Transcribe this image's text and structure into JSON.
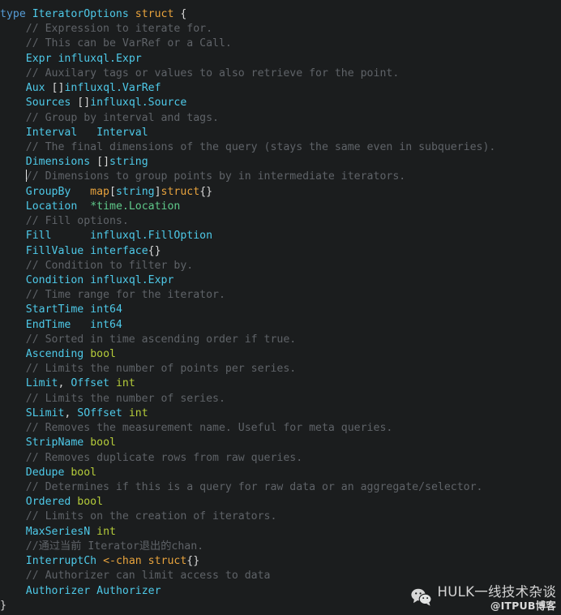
{
  "editor": {
    "background_color": "#1b1d1e",
    "language": "go",
    "cursor_line": 10,
    "cursor_column": 0
  },
  "theme": {
    "comment_color": "#5f6368",
    "keyword_color": "#569cd6",
    "identifier_color": "#4ec9e8",
    "type_color": "#e8a33d",
    "builtin_color": "#b5cc3a",
    "green_color": "#5fc98a",
    "punctuation_color": "#d8d8d8"
  },
  "code": {
    "lines": [
      {
        "id": "line-1",
        "indent": 0,
        "tokens": [
          {
            "t": "type",
            "c": "keyword"
          },
          {
            "t": " ",
            "c": "plain"
          },
          {
            "t": "IteratorOptions",
            "c": "ident"
          },
          {
            "t": " ",
            "c": "plain"
          },
          {
            "t": "struct",
            "c": "type"
          },
          {
            "t": " ",
            "c": "plain"
          },
          {
            "t": "{",
            "c": "punct"
          }
        ]
      },
      {
        "id": "line-2",
        "indent": 1,
        "tokens": [
          {
            "t": "// Expression to iterate for.",
            "c": "comment"
          }
        ]
      },
      {
        "id": "line-3",
        "indent": 1,
        "tokens": [
          {
            "t": "// This can be VarRef or a Call.",
            "c": "comment"
          }
        ]
      },
      {
        "id": "line-4",
        "indent": 1,
        "tokens": [
          {
            "t": "Expr",
            "c": "ident"
          },
          {
            "t": " ",
            "c": "plain"
          },
          {
            "t": "influxql.Expr",
            "c": "ident"
          }
        ]
      },
      {
        "id": "line-5",
        "indent": 1,
        "tokens": [
          {
            "t": "// Auxilary tags or values to also retrieve for the point.",
            "c": "comment"
          }
        ]
      },
      {
        "id": "line-6",
        "indent": 1,
        "tokens": [
          {
            "t": "Aux",
            "c": "ident"
          },
          {
            "t": " ",
            "c": "plain"
          },
          {
            "t": "[]",
            "c": "punct"
          },
          {
            "t": "influxql.VarRef",
            "c": "ident"
          }
        ]
      },
      {
        "id": "line-7",
        "indent": 1,
        "tokens": [
          {
            "t": "Sources",
            "c": "ident"
          },
          {
            "t": " ",
            "c": "plain"
          },
          {
            "t": "[]",
            "c": "punct"
          },
          {
            "t": "influxql.Source",
            "c": "ident"
          }
        ]
      },
      {
        "id": "line-8",
        "indent": 1,
        "tokens": [
          {
            "t": "// Group by interval and tags.",
            "c": "comment"
          }
        ]
      },
      {
        "id": "line-9",
        "indent": 1,
        "tokens": [
          {
            "t": "Interval",
            "c": "ident"
          },
          {
            "t": "   ",
            "c": "plain"
          },
          {
            "t": "Interval",
            "c": "ident"
          }
        ]
      },
      {
        "id": "line-10",
        "indent": 1,
        "tokens": [
          {
            "t": "// The final dimensions of the query (stays the same even in subqueries).",
            "c": "comment"
          }
        ]
      },
      {
        "id": "line-11",
        "indent": 1,
        "tokens": [
          {
            "t": "Dimensions",
            "c": "ident"
          },
          {
            "t": " ",
            "c": "plain"
          },
          {
            "t": "[]",
            "c": "punct"
          },
          {
            "t": "string",
            "c": "ident"
          }
        ]
      },
      {
        "id": "line-12",
        "indent": 1,
        "caret": true,
        "tokens": [
          {
            "t": "// Dimensions to group points by in intermediate iterators.",
            "c": "comment"
          }
        ]
      },
      {
        "id": "line-13",
        "indent": 1,
        "tokens": [
          {
            "t": "GroupBy",
            "c": "ident"
          },
          {
            "t": "   ",
            "c": "plain"
          },
          {
            "t": "map",
            "c": "type"
          },
          {
            "t": "[",
            "c": "punct"
          },
          {
            "t": "string",
            "c": "ident"
          },
          {
            "t": "]",
            "c": "punct"
          },
          {
            "t": "struct",
            "c": "type"
          },
          {
            "t": "{}",
            "c": "punct"
          }
        ]
      },
      {
        "id": "line-14",
        "indent": 1,
        "tokens": [
          {
            "t": "Location",
            "c": "ident"
          },
          {
            "t": "  ",
            "c": "plain"
          },
          {
            "t": "*time.Location",
            "c": "green"
          }
        ]
      },
      {
        "id": "line-15",
        "indent": 1,
        "tokens": [
          {
            "t": "// Fill options.",
            "c": "comment"
          }
        ]
      },
      {
        "id": "line-16",
        "indent": 1,
        "tokens": [
          {
            "t": "Fill",
            "c": "ident"
          },
          {
            "t": "      ",
            "c": "plain"
          },
          {
            "t": "influxql.FillOption",
            "c": "ident"
          }
        ]
      },
      {
        "id": "line-17",
        "indent": 1,
        "tokens": [
          {
            "t": "FillValue",
            "c": "ident"
          },
          {
            "t": " ",
            "c": "plain"
          },
          {
            "t": "interface",
            "c": "ident"
          },
          {
            "t": "{}",
            "c": "punct"
          }
        ]
      },
      {
        "id": "line-18",
        "indent": 1,
        "tokens": [
          {
            "t": "// Condition to filter by.",
            "c": "comment"
          }
        ]
      },
      {
        "id": "line-19",
        "indent": 1,
        "tokens": [
          {
            "t": "Condition",
            "c": "ident"
          },
          {
            "t": " ",
            "c": "plain"
          },
          {
            "t": "influxql.Expr",
            "c": "ident"
          }
        ]
      },
      {
        "id": "line-20",
        "indent": 1,
        "tokens": [
          {
            "t": "// Time range for the iterator.",
            "c": "comment"
          }
        ]
      },
      {
        "id": "line-21",
        "indent": 1,
        "tokens": [
          {
            "t": "StartTime",
            "c": "ident"
          },
          {
            "t": " ",
            "c": "plain"
          },
          {
            "t": "int64",
            "c": "ident"
          }
        ]
      },
      {
        "id": "line-22",
        "indent": 1,
        "tokens": [
          {
            "t": "EndTime",
            "c": "ident"
          },
          {
            "t": "   ",
            "c": "plain"
          },
          {
            "t": "int64",
            "c": "ident"
          }
        ]
      },
      {
        "id": "line-23",
        "indent": 1,
        "tokens": [
          {
            "t": "// Sorted in time ascending order if true.",
            "c": "comment"
          }
        ]
      },
      {
        "id": "line-24",
        "indent": 1,
        "tokens": [
          {
            "t": "Ascending",
            "c": "ident"
          },
          {
            "t": " ",
            "c": "plain"
          },
          {
            "t": "bool",
            "c": "builtin"
          }
        ]
      },
      {
        "id": "line-25",
        "indent": 1,
        "tokens": [
          {
            "t": "// Limits the number of points per series.",
            "c": "comment"
          }
        ]
      },
      {
        "id": "line-26",
        "indent": 1,
        "tokens": [
          {
            "t": "Limit",
            "c": "ident"
          },
          {
            "t": ", ",
            "c": "punct"
          },
          {
            "t": "Offset",
            "c": "ident"
          },
          {
            "t": " ",
            "c": "plain"
          },
          {
            "t": "int",
            "c": "builtin"
          }
        ]
      },
      {
        "id": "line-27",
        "indent": 1,
        "tokens": [
          {
            "t": "// Limits the number of series.",
            "c": "comment"
          }
        ]
      },
      {
        "id": "line-28",
        "indent": 1,
        "tokens": [
          {
            "t": "SLimit",
            "c": "ident"
          },
          {
            "t": ", ",
            "c": "punct"
          },
          {
            "t": "SOffset",
            "c": "ident"
          },
          {
            "t": " ",
            "c": "plain"
          },
          {
            "t": "int",
            "c": "builtin"
          }
        ]
      },
      {
        "id": "line-29",
        "indent": 1,
        "tokens": [
          {
            "t": "// Removes the measurement name. Useful for meta queries.",
            "c": "comment"
          }
        ]
      },
      {
        "id": "line-30",
        "indent": 1,
        "tokens": [
          {
            "t": "StripName",
            "c": "ident"
          },
          {
            "t": " ",
            "c": "plain"
          },
          {
            "t": "bool",
            "c": "builtin"
          }
        ]
      },
      {
        "id": "line-31",
        "indent": 1,
        "tokens": [
          {
            "t": "// Removes duplicate rows from raw queries.",
            "c": "comment"
          }
        ]
      },
      {
        "id": "line-32",
        "indent": 1,
        "tokens": [
          {
            "t": "Dedupe",
            "c": "ident"
          },
          {
            "t": " ",
            "c": "plain"
          },
          {
            "t": "bool",
            "c": "builtin"
          }
        ]
      },
      {
        "id": "line-33",
        "indent": 1,
        "tokens": [
          {
            "t": "// Determines if this is a query for raw data or an aggregate/selector.",
            "c": "comment"
          }
        ]
      },
      {
        "id": "line-34",
        "indent": 1,
        "tokens": [
          {
            "t": "Ordered",
            "c": "ident"
          },
          {
            "t": " ",
            "c": "plain"
          },
          {
            "t": "bool",
            "c": "builtin"
          }
        ]
      },
      {
        "id": "line-35",
        "indent": 1,
        "tokens": [
          {
            "t": "// Limits on the creation of iterators.",
            "c": "comment"
          }
        ]
      },
      {
        "id": "line-36",
        "indent": 1,
        "tokens": [
          {
            "t": "MaxSeriesN",
            "c": "ident"
          },
          {
            "t": " ",
            "c": "plain"
          },
          {
            "t": "int",
            "c": "builtin"
          }
        ]
      },
      {
        "id": "line-37",
        "indent": 1,
        "tokens": [
          {
            "t": "//通过当前 Iterator退出的chan.",
            "c": "comment"
          }
        ]
      },
      {
        "id": "line-38",
        "indent": 1,
        "tokens": [
          {
            "t": "InterruptCh",
            "c": "ident"
          },
          {
            "t": " ",
            "c": "plain"
          },
          {
            "t": "<-chan",
            "c": "type"
          },
          {
            "t": " ",
            "c": "plain"
          },
          {
            "t": "struct",
            "c": "type"
          },
          {
            "t": "{}",
            "c": "punct"
          }
        ]
      },
      {
        "id": "line-39",
        "indent": 1,
        "tokens": [
          {
            "t": "// Authorizer can limit access to data",
            "c": "comment"
          }
        ]
      },
      {
        "id": "line-40",
        "indent": 1,
        "tokens": [
          {
            "t": "Authorizer",
            "c": "ident"
          },
          {
            "t": " ",
            "c": "plain"
          },
          {
            "t": "Authorizer",
            "c": "ident"
          }
        ]
      },
      {
        "id": "line-41",
        "indent": 0,
        "tokens": [
          {
            "t": "}",
            "c": "punct"
          }
        ]
      }
    ]
  },
  "watermark": {
    "icon": "wechat-icon",
    "main_text": "HULK一线技术杂谈",
    "sub_text": "@ITPUB博客"
  }
}
